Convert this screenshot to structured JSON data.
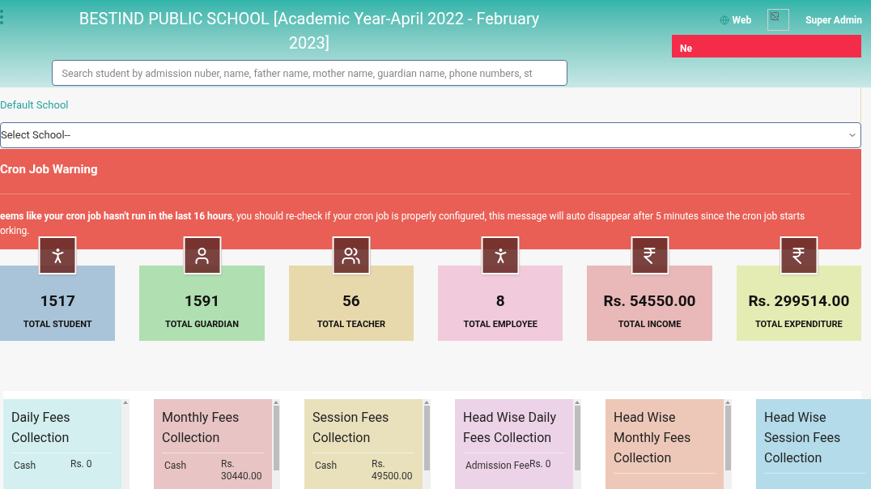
{
  "header": {
    "title": "BESTIND PUBLIC SCHOOL [Academic Year-April 2022 - February 2023]",
    "search": {
      "placeholder": "Search student by admission nuber, name, father name, mother name, guardian name, phone numbers, st"
    },
    "web_link": "Web",
    "user": "Super Admin",
    "notice_field": {
      "value": "Ne"
    }
  },
  "school": {
    "label": "Default School",
    "select_value": "Select School--"
  },
  "warning": {
    "title": "Cron Job Warning",
    "lines": [
      "**eems like your cron job hasn't run in the last 16 hours**, you should re-check if your cron job is properly configured, this message will auto disappear after 5 minutes since the cron job starts",
      "orking."
    ]
  },
  "stats": [
    {
      "kind": "student",
      "value": "1517",
      "label": "TOTAL STUDENT",
      "color": "#a9c4d8"
    },
    {
      "kind": "guardian",
      "value": "1591",
      "label": "TOTAL GUARDIAN",
      "color": "#b0dfb1"
    },
    {
      "kind": "teacher",
      "value": "56",
      "label": "TOTAL TEACHER",
      "color": "#e7d9ab"
    },
    {
      "kind": "employee",
      "value": "8",
      "label": "TOTAL EMPLOYEE",
      "color": "#f1cadb"
    },
    {
      "kind": "money",
      "value": "Rs. 54550.00",
      "label": "TOTAL INCOME",
      "color": "#e8b9b8"
    },
    {
      "kind": "money",
      "value": "Rs. 299514.00",
      "label": "TOTAL EXPENDITURE",
      "color": "#e4ecb4"
    }
  ],
  "fee_cards": [
    {
      "title": "Daily Fees Collection",
      "color": "#d3eff0",
      "rows": [
        {
          "label": "Cash",
          "amount": "Rs. 0"
        }
      ]
    },
    {
      "title": "Monthly Fees Collection",
      "color": "#e8c4c4",
      "rows": [
        {
          "label": "Cash",
          "amount": "Rs. 30440.00"
        }
      ]
    },
    {
      "title": "Session Fees Collection",
      "color": "#e9e1bc",
      "rows": [
        {
          "label": "Cash",
          "amount": "Rs. 49500.00"
        }
      ]
    },
    {
      "title": "Head Wise Daily Fees Collection",
      "color": "#ecd3e8",
      "rows": [
        {
          "label": "Admission Fee",
          "amount": "Rs. 0"
        }
      ]
    },
    {
      "title": "Head Wise Monthly Fees Collection",
      "color": "#edc8b8"
    },
    {
      "title": "Head Wise Session Fees Collection",
      "color": "#b3dbe9"
    }
  ]
}
